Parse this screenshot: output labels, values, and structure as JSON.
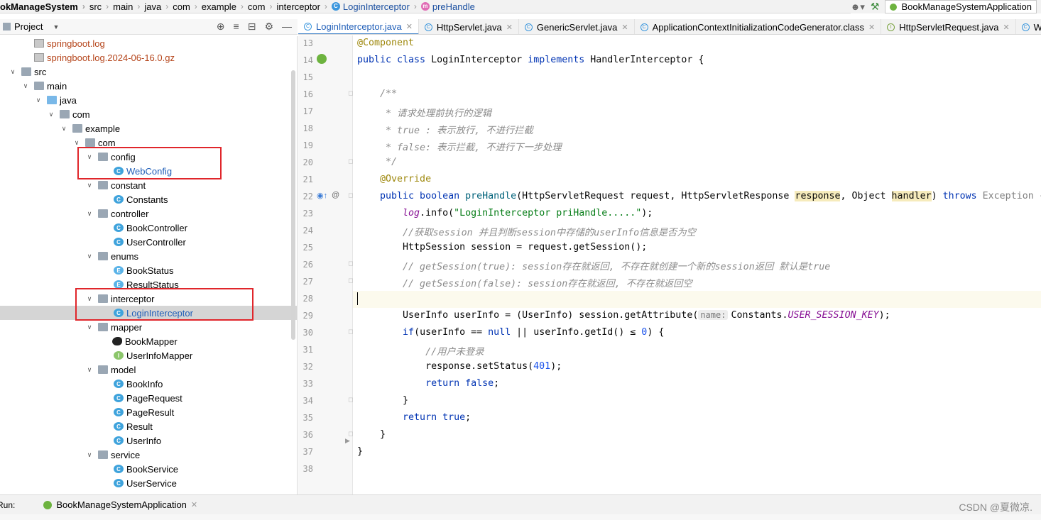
{
  "breadcrumb": {
    "items": [
      "okManageSystem",
      "src",
      "main",
      "java",
      "com",
      "example",
      "com",
      "interceptor",
      "LoginInterceptor",
      "preHandle"
    ]
  },
  "toolbar": {
    "run_config": "BookManageSystemApplication"
  },
  "project_panel": {
    "title": "Project"
  },
  "tree": [
    {
      "label": "springboot.log",
      "kind": "log"
    },
    {
      "label": "springboot.log.2024-06-16.0.gz",
      "kind": "log"
    },
    {
      "label": "src",
      "kind": "folder"
    },
    {
      "label": "main",
      "kind": "folder"
    },
    {
      "label": "java",
      "kind": "folder"
    },
    {
      "label": "com",
      "kind": "folder"
    },
    {
      "label": "example",
      "kind": "folder"
    },
    {
      "label": "com",
      "kind": "folder"
    },
    {
      "label": "config",
      "kind": "folder"
    },
    {
      "label": "WebConfig",
      "kind": "class"
    },
    {
      "label": "constant",
      "kind": "folder"
    },
    {
      "label": "Constants",
      "kind": "class"
    },
    {
      "label": "controller",
      "kind": "folder"
    },
    {
      "label": "BookController",
      "kind": "class"
    },
    {
      "label": "UserController",
      "kind": "class"
    },
    {
      "label": "enums",
      "kind": "folder"
    },
    {
      "label": "BookStatus",
      "kind": "enum"
    },
    {
      "label": "ResultStatus",
      "kind": "enum"
    },
    {
      "label": "interceptor",
      "kind": "folder"
    },
    {
      "label": "LoginInterceptor",
      "kind": "class"
    },
    {
      "label": "mapper",
      "kind": "folder"
    },
    {
      "label": "BookMapper",
      "kind": "mybatis"
    },
    {
      "label": "UserInfoMapper",
      "kind": "interface"
    },
    {
      "label": "model",
      "kind": "folder"
    },
    {
      "label": "BookInfo",
      "kind": "class"
    },
    {
      "label": "PageRequest",
      "kind": "class"
    },
    {
      "label": "PageResult",
      "kind": "class"
    },
    {
      "label": "Result",
      "kind": "class"
    },
    {
      "label": "UserInfo",
      "kind": "class"
    },
    {
      "label": "service",
      "kind": "folder"
    },
    {
      "label": "BookService",
      "kind": "class"
    },
    {
      "label": "UserService",
      "kind": "class"
    }
  ],
  "tabs": [
    {
      "label": "LoginInterceptor.java",
      "icon": "class-icon"
    },
    {
      "label": "HttpServlet.java",
      "icon": "class-icon"
    },
    {
      "label": "GenericServlet.java",
      "icon": "class-icon"
    },
    {
      "label": "ApplicationContextInitializationCodeGenerator.class",
      "icon": "class-icon"
    },
    {
      "label": "HttpServletRequest.java",
      "icon": "interface-icon"
    },
    {
      "label": "W",
      "icon": "class-icon"
    }
  ],
  "line_numbers": [
    "13",
    "14",
    "15",
    "16",
    "17",
    "18",
    "19",
    "20",
    "21",
    "22",
    "23",
    "24",
    "25",
    "26",
    "27",
    "28",
    "29",
    "30",
    "31",
    "32",
    "33",
    "34",
    "35",
    "36",
    "37",
    "38"
  ],
  "code": {
    "l13": "@Component",
    "l14_kw1": "public class",
    "l14_name": " LoginInterceptor ",
    "l14_kw2": "implements",
    "l14_rest": " HandlerInterceptor {",
    "l16": "    /**",
    "l17": "     * 请求处理前执行的逻辑",
    "l18": "     * true : 表示放行, 不进行拦截",
    "l19": "     * false: 表示拦截, 不进行下一步处理",
    "l20": "     */",
    "l21": "    @Override",
    "l22_kw": "    public boolean ",
    "l22_m": "preHandle",
    "l22_a": "(HttpServletRequest request, HttpServletResponse ",
    "l22_p1": "response",
    "l22_b": ", Object ",
    "l22_p2": "handler",
    "l22_c": ") ",
    "l22_kw2": "throws",
    "l22_d": " Exception {",
    "l23_f": "        log",
    "l23_a": ".info(",
    "l23_s": "\"LoginInterceptor priHandle.....\"",
    "l23_b": ");",
    "l24": "        //获取session 并且判断session中存储的userInfo信息是否为空",
    "l25": "        HttpSession session = request.getSession();",
    "l26": "        // getSession(true): session存在就返回, 不存在就创建一个新的session返回 默认是true",
    "l27": "        // getSession(false): session存在就返回, 不存在就返回空",
    "l29_a": "        UserInfo userInfo = (UserInfo) session.getAttribute(",
    "l29_hint": "name:",
    "l29_b": "Constants.",
    "l29_f": "USER_SESSION_KEY",
    "l29_c": ");",
    "l30_kw": "        if",
    "l30_a": "(userInfo == ",
    "l30_null": "null",
    "l30_b": " || userInfo.getId() ≤ ",
    "l30_num": "0",
    "l30_c": ") {",
    "l31": "            //用户未登录",
    "l32_a": "            response.setStatus(",
    "l32_num": "401",
    "l32_b": ");",
    "l33_kw": "            return false",
    "l33_b": ";",
    "l34": "        }",
    "l35_kw": "        return true",
    "l35_b": ";",
    "l36": "    }",
    "l37": "}"
  },
  "runbar": {
    "label": "Run:",
    "tab": "BookManageSystemApplication"
  },
  "watermark": "CSDN @夏微凉."
}
